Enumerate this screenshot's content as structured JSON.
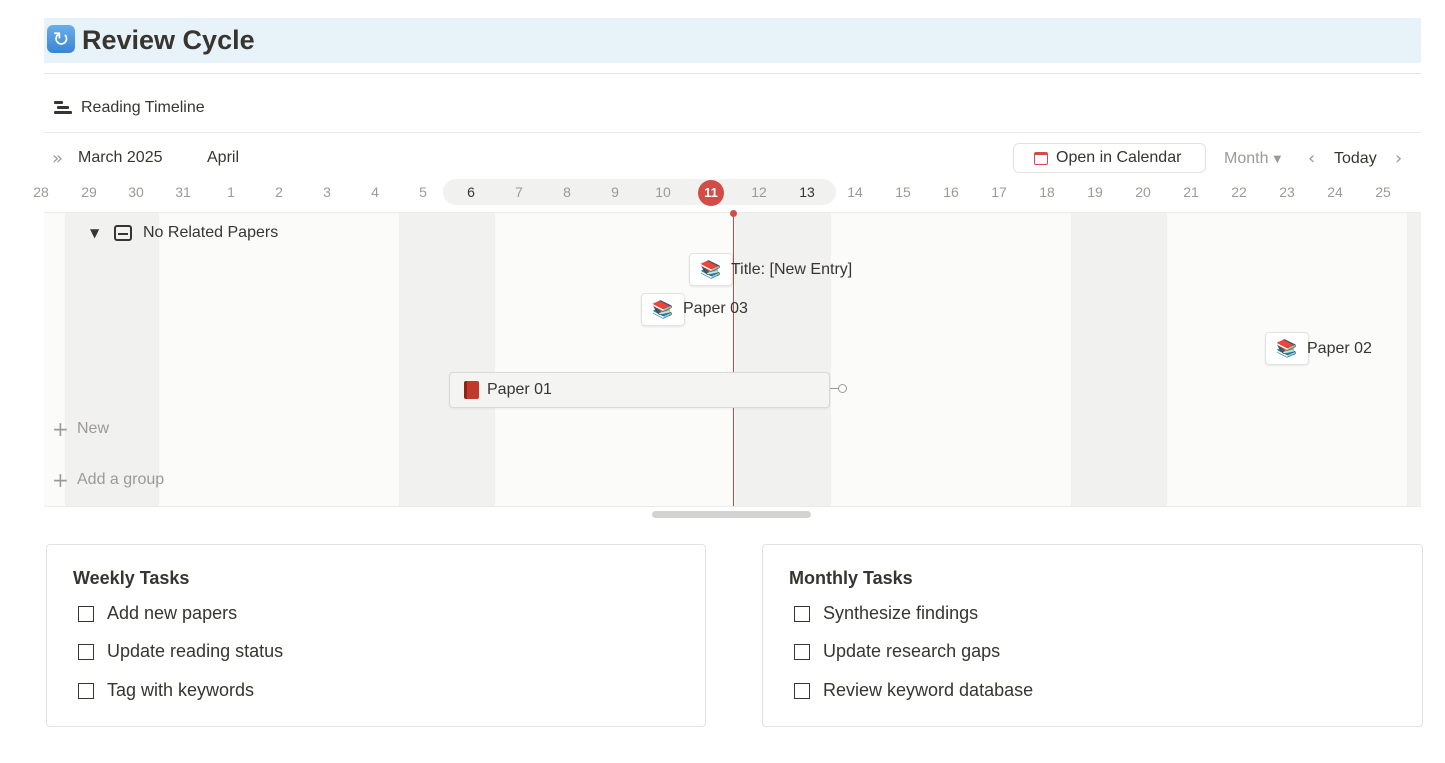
{
  "page": {
    "icon": "cycle-arrows-icon",
    "title": "Review Cycle",
    "title_background": "#e7f3f8"
  },
  "view": {
    "icon": "timeline-icon",
    "title": "Reading Timeline"
  },
  "timeline": {
    "months": [
      "March 2025",
      "April"
    ],
    "open_calendar_label": "Open in Calendar",
    "zoom_label": "Month",
    "today_label": "Today",
    "days": [
      "28",
      "29",
      "30",
      "31",
      "1",
      "2",
      "3",
      "4",
      "5",
      "6",
      "7",
      "8",
      "9",
      "10",
      "11",
      "12",
      "13",
      "14",
      "15",
      "16",
      "17",
      "18",
      "19",
      "20",
      "21",
      "22",
      "23",
      "24",
      "25"
    ],
    "today": "11",
    "accent_color": "#d44c47",
    "group": {
      "label": "No Related Papers",
      "collapsed": false
    },
    "items": [
      {
        "icon": "books-icon",
        "label": "Title: [New Entry]"
      },
      {
        "icon": "books-icon",
        "label": "Paper 03"
      },
      {
        "icon": "books-icon",
        "label": "Paper 02"
      },
      {
        "icon": "red-book-icon",
        "label": "Paper 01"
      }
    ],
    "new_label": "New",
    "add_group_label": "Add a group"
  },
  "weekly": {
    "title": "Weekly Tasks",
    "tasks": [
      {
        "label": "Add new papers",
        "checked": false
      },
      {
        "label": "Update reading status",
        "checked": false
      },
      {
        "label": "Tag with keywords",
        "checked": false
      }
    ]
  },
  "monthly": {
    "title": "Monthly Tasks",
    "tasks": [
      {
        "label": "Synthesize findings",
        "checked": false
      },
      {
        "label": "Update research gaps",
        "checked": false
      },
      {
        "label": "Review keyword database",
        "checked": false
      }
    ]
  }
}
